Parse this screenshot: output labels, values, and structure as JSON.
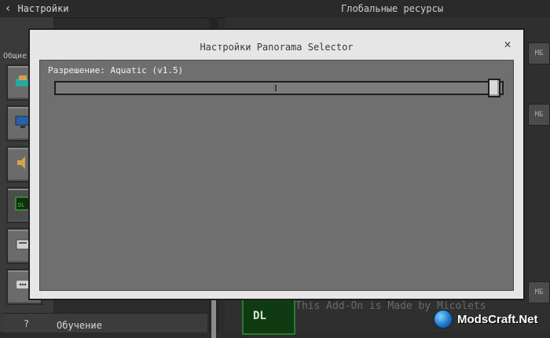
{
  "header": {
    "back_label": "Настройки",
    "section_title": "Глобальные ресурсы"
  },
  "sidebar": {
    "general_label": "Общие",
    "icons": [
      "teal-block-icon",
      "monitor-icon",
      "speaker-icon",
      "terminal-icon",
      "storage-icon",
      "chat-icon"
    ],
    "help_label": "Обучение"
  },
  "background_pack": {
    "description": "This Add-On is Made by Micolets"
  },
  "watermark": {
    "text": "ModsCraft.Net"
  },
  "dialog": {
    "title": "Настройки Panorama Selector",
    "close_symbol": "✕",
    "setting": {
      "label": "Разрешение: Aquatic (v1.5)",
      "slider_value": 1.0
    }
  },
  "colors": {
    "dialog_frame": "#e6e6e6",
    "dialog_body": "#6f6f6f",
    "slider_handle": "#d9d9d9"
  }
}
